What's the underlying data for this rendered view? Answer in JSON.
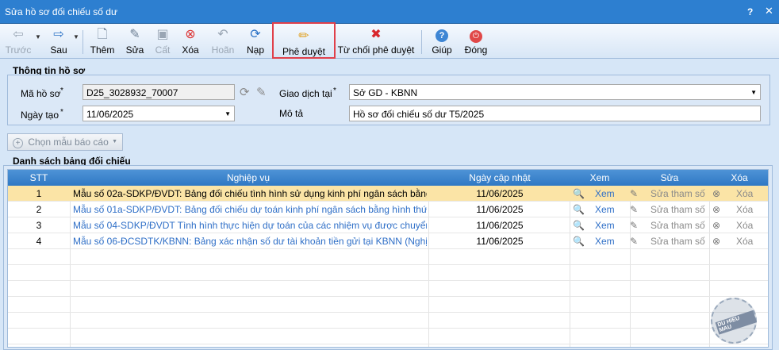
{
  "window": {
    "title": "Sửa hồ sơ đối chiếu số dư",
    "help": "?",
    "close": "✕"
  },
  "toolbar": {
    "prev": "Trước",
    "next": "Sau",
    "add": "Thêm",
    "edit": "Sửa",
    "save": "Cất",
    "delete": "Xóa",
    "undo": "Hoãn",
    "reload": "Nạp",
    "approve": "Phê duyệt",
    "reject": "Từ chối phê duyệt",
    "help": "Giúp",
    "close": "Đóng"
  },
  "info": {
    "title": "Thông tin hồ sơ",
    "code_label": "Mã hồ sơ",
    "code_value": "D25_3028932_70007",
    "date_label": "Ngày tạo",
    "date_value": "11/06/2025",
    "trans_label": "Giao dịch tại",
    "trans_value": "Sở GD - KBNN",
    "desc_label": "Mô tả",
    "desc_value": "Hồ sơ đối chiếu số dư T5/2025",
    "required_mark": "*"
  },
  "template_button": "Chọn mẫu báo cáo",
  "list": {
    "title": "Danh sách bảng đối chiếu",
    "headers": {
      "stt": "STT",
      "op": "Nghiệp vụ",
      "date": "Ngày cập nhật",
      "view": "Xem",
      "edit": "Sửa",
      "del": "Xóa"
    },
    "rows": [
      {
        "stt": "1",
        "op": "Mẫu số 02a-SDKP/ĐVDT: Bảng đối chiếu tình hình sử dụng kinh phí ngân sách bằng hình",
        "date": "11/06/2025",
        "view": "Xem",
        "edit": "Sửa tham số",
        "del": "Xóa"
      },
      {
        "stt": "2",
        "op": "Mẫu số 01a-SDKP/ĐVDT: Bảng đối chiếu dự toán kinh phí ngân sách bằng hình thức rút d",
        "date": "11/06/2025",
        "view": "Xem",
        "edit": "Sửa tham số",
        "del": "Xóa"
      },
      {
        "stt": "3",
        "op": "Mẫu số 04-SDKP/ĐVDT Tình hình thực hiện dự toán của các nhiệm vụ được chuyển nguồ",
        "date": "11/06/2025",
        "view": "Xem",
        "edit": "Sửa tham số",
        "del": "Xóa"
      },
      {
        "stt": "4",
        "op": "Mẫu số 06-ĐCSDTK/KBNN: Bảng xác nhận số dư tài khoản tiền gửi tại KBNN (Nghị định",
        "date": "11/06/2025",
        "view": "Xem",
        "edit": "Sửa tham số",
        "del": "Xóa"
      }
    ]
  },
  "watermark": "DU HIEU MAU",
  "colors": {
    "titlebar": "#2d7fd0",
    "grid_header": "#3a83cc",
    "selected_row": "#fbe4a6",
    "link": "#2f6fc7",
    "highlight": "#e0404a"
  }
}
